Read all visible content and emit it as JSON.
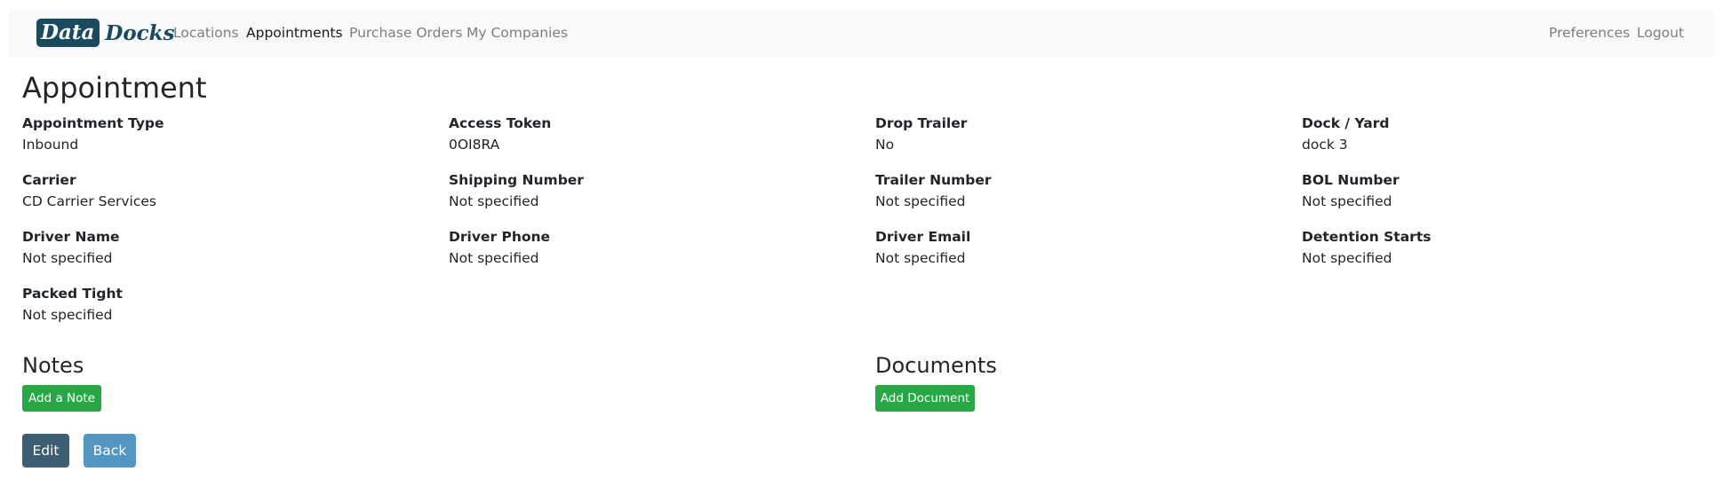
{
  "navbar": {
    "brand_part1": "Data",
    "brand_part2": "Docks",
    "links": [
      {
        "label": "Locations"
      },
      {
        "label": "Appointments"
      },
      {
        "label": "Purchase Orders"
      },
      {
        "label": "My Companies"
      }
    ],
    "right_links": [
      {
        "label": "Preferences"
      },
      {
        "label": "Logout"
      }
    ],
    "active_link": "Appointments"
  },
  "page": {
    "title": "Appointment"
  },
  "fields": [
    {
      "label": "Appointment Type",
      "value": "Inbound"
    },
    {
      "label": "Access Token",
      "value": "0OI8RA"
    },
    {
      "label": "Drop Trailer",
      "value": "No"
    },
    {
      "label": "Dock / Yard",
      "value": "dock 3"
    },
    {
      "label": "Carrier",
      "value": "CD Carrier Services"
    },
    {
      "label": "Shipping Number",
      "value": "Not specified"
    },
    {
      "label": "Trailer Number",
      "value": "Not specified"
    },
    {
      "label": "BOL Number",
      "value": "Not specified"
    },
    {
      "label": "Driver Name",
      "value": "Not specified"
    },
    {
      "label": "Driver Phone",
      "value": "Not specified"
    },
    {
      "label": "Driver Email",
      "value": "Not specified"
    },
    {
      "label": "Detention Starts",
      "value": "Not specified"
    },
    {
      "label": "Packed Tight",
      "value": "Not specified"
    }
  ],
  "notes": {
    "title": "Notes",
    "add_label": "Add a Note"
  },
  "documents": {
    "title": "Documents",
    "add_label": "Add Document"
  },
  "actions": {
    "edit_label": "Edit",
    "back_label": "Back"
  },
  "colors": {
    "brand": "#1a4a60",
    "navbar_bg": "#f8f9fa",
    "success": "#28a745",
    "edit": "#3c5e72",
    "back": "#5496c2"
  }
}
